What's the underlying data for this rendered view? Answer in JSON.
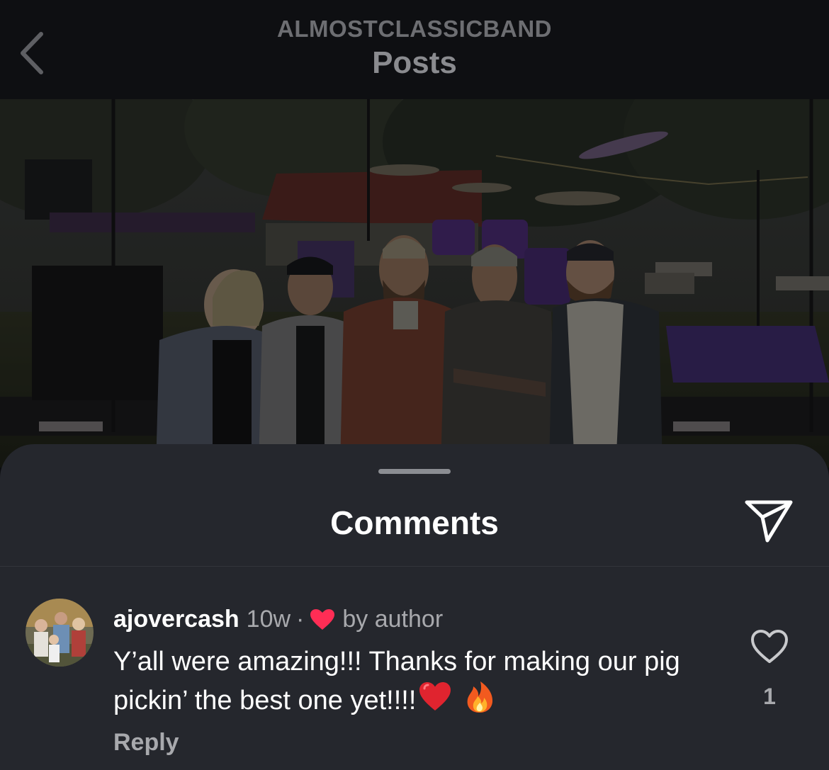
{
  "header": {
    "account": "ALMOSTCLASSICBAND",
    "title": "Posts"
  },
  "photo": {
    "icon": "band-photo"
  },
  "sheet": {
    "title": "Comments"
  },
  "comment": {
    "username": "ajovercash",
    "time": "10w",
    "separator": "·",
    "liked_by": "by author",
    "text": "Y’all were amazing!!! Thanks for making our pig pickin’ the best one yet!!!!",
    "emojis": [
      "red-heart-emoji",
      "fire-emoji"
    ],
    "reply_label": "Reply",
    "like_count": "1"
  },
  "colors": {
    "sheet_bg": "#25272d",
    "header_bg": "#0e0f12",
    "heart_red": "#ff2d55",
    "muted_text": "#a8a9ad"
  }
}
